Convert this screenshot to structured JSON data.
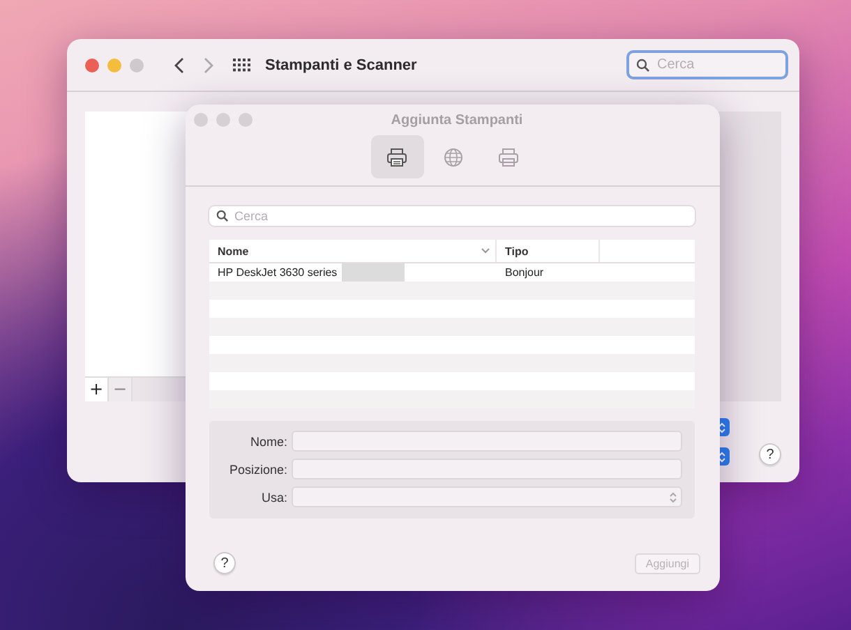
{
  "back_window": {
    "title": "Stampanti e Scanner",
    "search": {
      "placeholder": "Cerca"
    },
    "list_buttons": [
      {
        "label": "+",
        "disabled": false
      },
      {
        "label": "−",
        "disabled": true
      }
    ],
    "help": "?"
  },
  "dialog": {
    "title": "Aggiunta Stampanti",
    "toolbar": [
      {
        "kind": "printer",
        "selected": true
      },
      {
        "kind": "globe",
        "selected": false
      },
      {
        "kind": "printer-outline",
        "selected": false
      }
    ],
    "search": {
      "placeholder": "Cerca"
    },
    "table": {
      "columns": [
        "Nome",
        "Tipo"
      ],
      "rows": [
        {
          "name": "HP DeskJet 3630 series",
          "type": "Bonjour",
          "selected": false
        }
      ]
    },
    "form": [
      {
        "label": "Nome:",
        "kind": "text"
      },
      {
        "label": "Posizione:",
        "kind": "text"
      },
      {
        "label": "Usa:",
        "kind": "select"
      }
    ],
    "help": "?",
    "add_button": {
      "label": "Aggiungi",
      "disabled": true
    }
  }
}
